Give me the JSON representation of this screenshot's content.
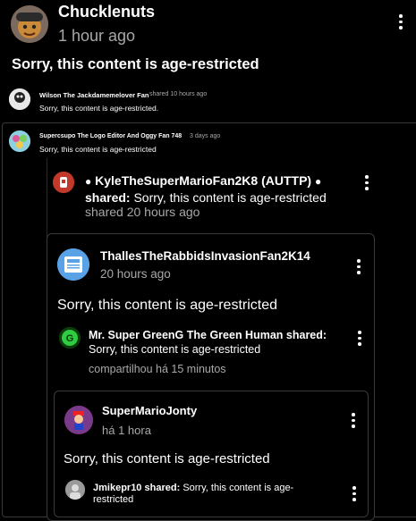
{
  "post": {
    "author": "Chucklenuts",
    "time": "1 hour ago",
    "text": "Sorry, this content is age-restricted"
  },
  "comments": [
    {
      "author": "Wilson The Jackdamemelover Fan",
      "meta": "shared 10 hours ago",
      "text": "Sorry, this content is age-restricted."
    },
    {
      "author": "Supercsupo The Logo Editor And Oggy Fan 748",
      "meta": "3 days ago",
      "text": "Sorry, this content is age-restricted"
    }
  ],
  "share1": {
    "author": "KyleTheSuperMarioFan2K8 (AUTTP)",
    "shared_label": "shared:",
    "text": "Sorry, this content is age-restricted",
    "time": "shared 20 hours ago"
  },
  "card1": {
    "author": "ThallesTheRabbidsInvasionFan2K14",
    "time": "20 hours ago",
    "text": "Sorry, this content is age-restricted"
  },
  "share2": {
    "author": "Mr. Super GreenG The Green Human",
    "shared_label": "shared:",
    "text": "Sorry, this content is age-restricted",
    "time": "compartilhou há 15 minutos"
  },
  "card2": {
    "author": "SuperMarioJonty",
    "time": "há 1 hora",
    "text": "Sorry, this content is age-restricted"
  },
  "share3": {
    "author": "Jmikepr10",
    "shared_label": "shared:",
    "text": "Sorry, this content is age-",
    "text_cont": "restricted"
  },
  "colors": {
    "background": "#000000",
    "card_border": "#3a3a3a",
    "muted_text": "#a8a8a8"
  }
}
